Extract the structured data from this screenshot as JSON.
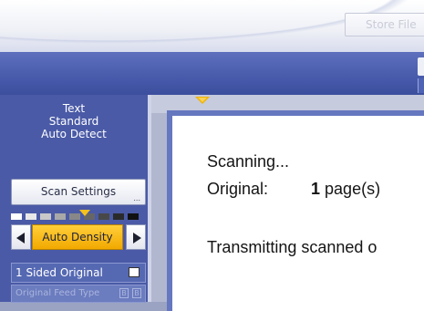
{
  "header": {
    "store_file_label": "Store File"
  },
  "scan_panel": {
    "mode_lines": [
      "Text",
      "Standard",
      "Auto Detect"
    ],
    "scan_settings_label": "Scan Settings",
    "scan_settings_more": "...",
    "density": {
      "label": "Auto Density"
    },
    "sided_label": "1 Sided Original",
    "feed_type_label": "Original Feed Type"
  },
  "dialog": {
    "status": "Scanning...",
    "original_label": "Original:",
    "page_count": "1",
    "page_unit": "page(s)",
    "transmit_text": "Transmitting scanned o"
  },
  "colors": {
    "accent_yellow": "#f2a900",
    "panel_blue": "#4a5aa6",
    "bar_blue": "#4457a8"
  }
}
